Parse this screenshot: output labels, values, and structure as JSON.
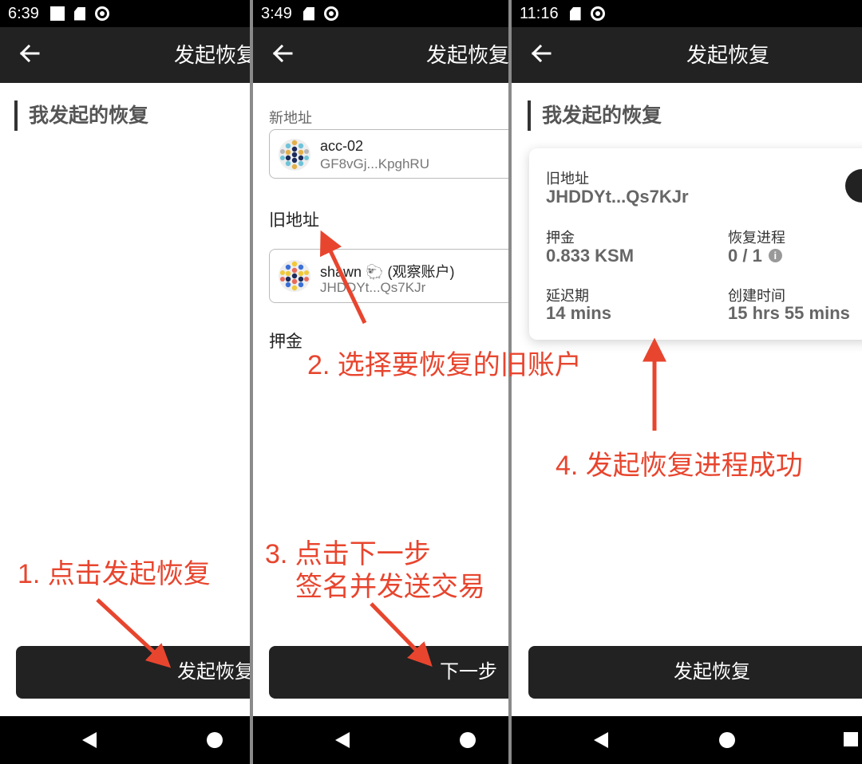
{
  "colors": {
    "accent_red": "#e8452e",
    "dark": "#222222",
    "status_bar": "#000000"
  },
  "icons": {
    "back": "arrow-left-icon",
    "status_sd": "sd-card-icon",
    "status_sync": "sync-icon",
    "info": "info-icon"
  },
  "panel1": {
    "status_time": "6:39",
    "title": "发起恢复",
    "section_title": "我发起的恢复",
    "button_label": "发起恢复",
    "annotation": "1. 点击发起恢复"
  },
  "panel2": {
    "status_time": "3:49",
    "title": "发起恢复",
    "new_address_label": "新地址",
    "new_account": {
      "name": "acc-02",
      "address": "GF8vGj...KpghRU"
    },
    "old_address_label": "旧地址",
    "old_account": {
      "name": "shawn 🐑 (观察账户)",
      "address": "JHDDYt...Qs7KJr"
    },
    "deposit_label": "押金",
    "button_label": "下一步",
    "annotation_2": "2. 选择要恢复的旧账户",
    "annotation_3_line1": "3. 点击下一步",
    "annotation_3_line2": "签名并发送交易"
  },
  "panel3": {
    "status_time": "11:16",
    "title": "发起恢复",
    "section_title": "我发起的恢复",
    "card": {
      "old_address_label": "旧地址",
      "old_address": "JHDDYt...Qs7KJr",
      "deposit_label": "押金",
      "deposit_value": "0.833 KSM",
      "progress_label": "恢复进程",
      "progress_value": "0 / 1",
      "delay_label": "延迟期",
      "delay_value": "14 mins",
      "created_label": "创建时间",
      "created_value": "15 hrs 55 mins"
    },
    "button_label": "发起恢复",
    "annotation": "4. 发起恢复进程成功"
  }
}
